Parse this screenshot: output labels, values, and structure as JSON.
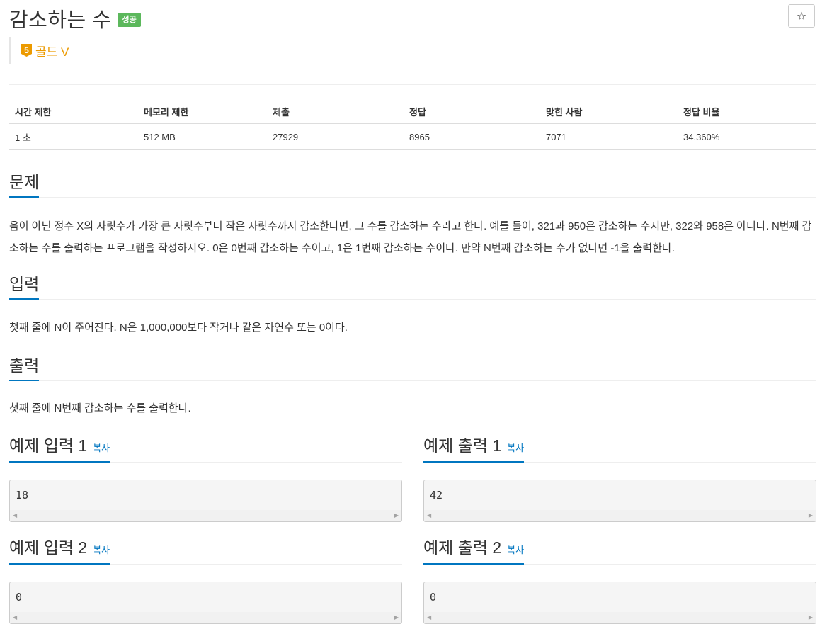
{
  "problem": {
    "title": "감소하는 수",
    "status_badge": "성공",
    "tier_number": "5",
    "tier_label": "골드 V",
    "star_icon": "☆"
  },
  "stats": {
    "headers": [
      "시간 제한",
      "메모리 제한",
      "제출",
      "정답",
      "맞힌 사람",
      "정답 비율"
    ],
    "values": [
      "1 초",
      "512 MB",
      "27929",
      "8965",
      "7071",
      "34.360%"
    ]
  },
  "sections": {
    "description": {
      "heading": "문제",
      "text": "음이 아닌 정수 X의 자릿수가 가장 큰 자릿수부터 작은 자릿수까지 감소한다면, 그 수를 감소하는 수라고 한다. 예를 들어, 321과 950은 감소하는 수지만, 322와 958은 아니다. N번째 감소하는 수를 출력하는 프로그램을 작성하시오. 0은 0번째 감소하는 수이고, 1은 1번째 감소하는 수이다. 만약 N번째 감소하는 수가 없다면 -1을 출력한다."
    },
    "input": {
      "heading": "입력",
      "text": "첫째 줄에 N이 주어진다. N은 1,000,000보다 작거나 같은 자연수 또는 0이다."
    },
    "output": {
      "heading": "출력",
      "text": "첫째 줄에 N번째 감소하는 수를 출력한다."
    }
  },
  "samples": {
    "copy_label": "복사",
    "input1": {
      "heading": "예제 입력 1",
      "value": "18"
    },
    "output1": {
      "heading": "예제 출력 1",
      "value": "42"
    },
    "input2": {
      "heading": "예제 입력 2",
      "value": "0"
    },
    "output2": {
      "heading": "예제 출력 2",
      "value": "0"
    }
  },
  "colors": {
    "accent": "#0076c0",
    "success": "#5cb85c",
    "gold_tier": "#ec9a00"
  }
}
